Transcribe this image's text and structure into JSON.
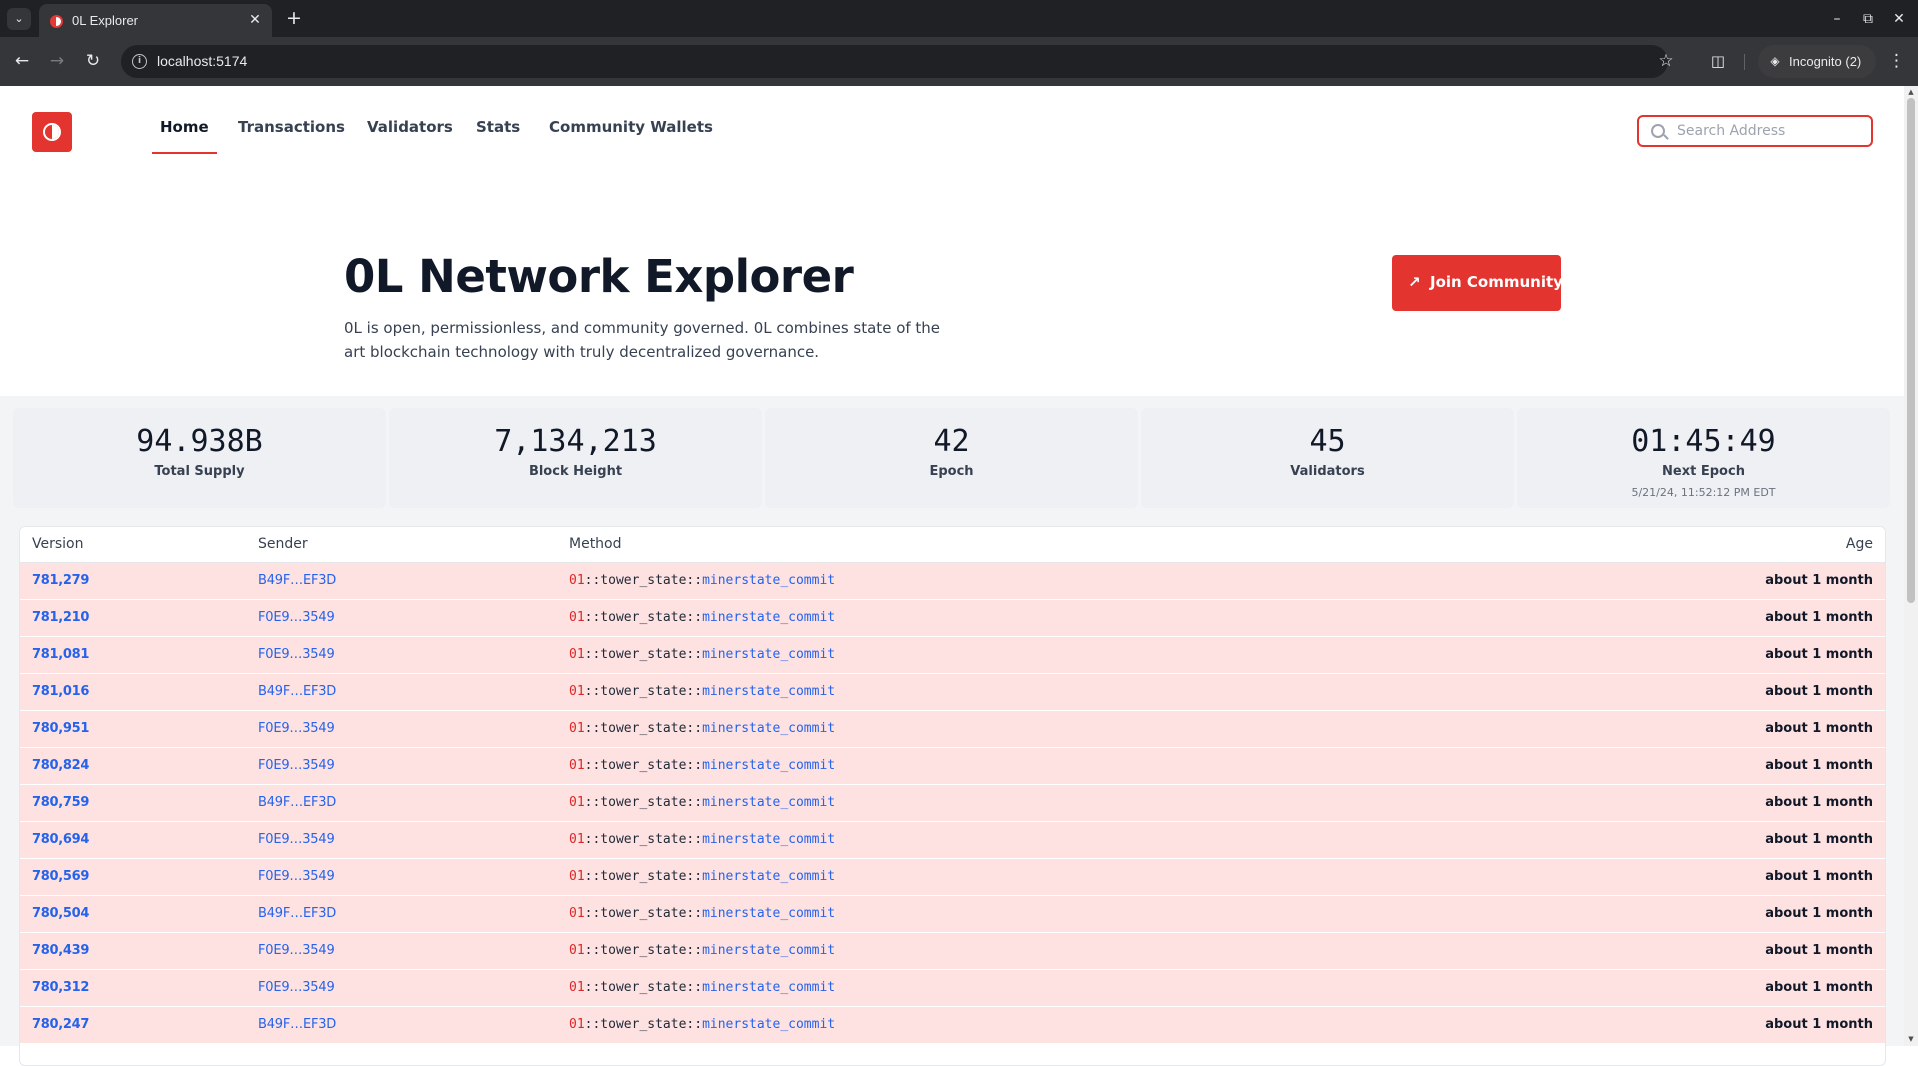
{
  "browser": {
    "tab_title": "0L Explorer",
    "url": "localhost:5174",
    "profile_label": "Incognito (2)"
  },
  "colors": {
    "brand": "#e3342f",
    "row_bg": "#fee2e2",
    "link": "#2563eb"
  },
  "header": {
    "nav": [
      {
        "label": "Home",
        "active": true
      },
      {
        "label": "Transactions",
        "active": false
      },
      {
        "label": "Validators",
        "active": false
      },
      {
        "label": "Stats",
        "active": false
      },
      {
        "label": "Community Wallets",
        "active": false
      }
    ],
    "search_placeholder": "Search Address"
  },
  "hero": {
    "title": "0L Network Explorer",
    "description": "0L is open, permissionless, and community governed. 0L combines state of the art blockchain technology with truly decentralized governance.",
    "join_label": "Join Community"
  },
  "stats": [
    {
      "value": "94.938B",
      "label": "Total Supply",
      "sub": ""
    },
    {
      "value": "7,134,213",
      "label": "Block Height",
      "sub": ""
    },
    {
      "value": "42",
      "label": "Epoch",
      "sub": ""
    },
    {
      "value": "45",
      "label": "Validators",
      "sub": ""
    },
    {
      "value": "01:45:49",
      "label": "Next Epoch",
      "sub": "5/21/24, 11:52:12 PM EDT"
    }
  ],
  "table": {
    "columns": [
      "Version",
      "Sender",
      "Method",
      "Age"
    ],
    "rows": [
      {
        "version": "781,279",
        "sender": "B49F…EF3D",
        "addr": "01",
        "module": "::tower_state::",
        "fn": "minerstate_commit",
        "age": "about 1 month"
      },
      {
        "version": "781,210",
        "sender": "F0E9…3549",
        "addr": "01",
        "module": "::tower_state::",
        "fn": "minerstate_commit",
        "age": "about 1 month"
      },
      {
        "version": "781,081",
        "sender": "F0E9…3549",
        "addr": "01",
        "module": "::tower_state::",
        "fn": "minerstate_commit",
        "age": "about 1 month"
      },
      {
        "version": "781,016",
        "sender": "B49F…EF3D",
        "addr": "01",
        "module": "::tower_state::",
        "fn": "minerstate_commit",
        "age": "about 1 month"
      },
      {
        "version": "780,951",
        "sender": "F0E9…3549",
        "addr": "01",
        "module": "::tower_state::",
        "fn": "minerstate_commit",
        "age": "about 1 month"
      },
      {
        "version": "780,824",
        "sender": "F0E9…3549",
        "addr": "01",
        "module": "::tower_state::",
        "fn": "minerstate_commit",
        "age": "about 1 month"
      },
      {
        "version": "780,759",
        "sender": "B49F…EF3D",
        "addr": "01",
        "module": "::tower_state::",
        "fn": "minerstate_commit",
        "age": "about 1 month"
      },
      {
        "version": "780,694",
        "sender": "F0E9…3549",
        "addr": "01",
        "module": "::tower_state::",
        "fn": "minerstate_commit",
        "age": "about 1 month"
      },
      {
        "version": "780,569",
        "sender": "F0E9…3549",
        "addr": "01",
        "module": "::tower_state::",
        "fn": "minerstate_commit",
        "age": "about 1 month"
      },
      {
        "version": "780,504",
        "sender": "B49F…EF3D",
        "addr": "01",
        "module": "::tower_state::",
        "fn": "minerstate_commit",
        "age": "about 1 month"
      },
      {
        "version": "780,439",
        "sender": "F0E9…3549",
        "addr": "01",
        "module": "::tower_state::",
        "fn": "minerstate_commit",
        "age": "about 1 month"
      },
      {
        "version": "780,312",
        "sender": "F0E9…3549",
        "addr": "01",
        "module": "::tower_state::",
        "fn": "minerstate_commit",
        "age": "about 1 month"
      },
      {
        "version": "780,247",
        "sender": "B49F…EF3D",
        "addr": "01",
        "module": "::tower_state::",
        "fn": "minerstate_commit",
        "age": "about 1 month"
      }
    ]
  }
}
